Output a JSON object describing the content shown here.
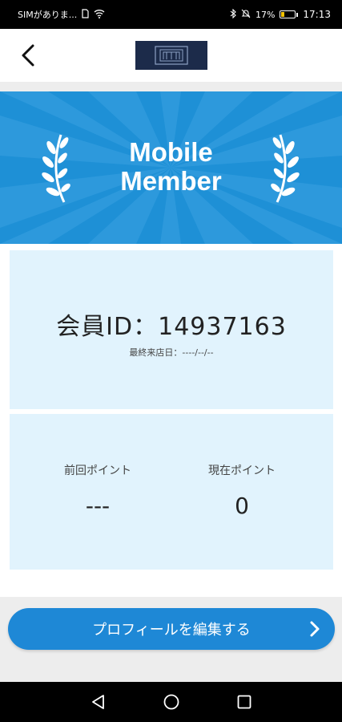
{
  "status_bar": {
    "carrier": "SIMがありま...",
    "battery_percent": "17%",
    "time": "17:13",
    "icons": [
      "sim-card-icon",
      "wifi-icon",
      "bluetooth-icon",
      "mute-icon",
      "battery-icon"
    ]
  },
  "header": {
    "back_icon": "chevron-left-icon",
    "logo_icon": "brand-logo"
  },
  "banner": {
    "title": "Mobile\nMember",
    "color": "#1e90d6"
  },
  "member": {
    "id_text": "会員ID：14937163",
    "last_visit": "最終来店日：----/--/--"
  },
  "points": {
    "previous_label": "前回ポイント",
    "previous_value": "---",
    "current_label": "現在ポイント",
    "current_value": "0"
  },
  "profile_button": {
    "label": "プロフィールを編集する",
    "color": "#1e88d6"
  },
  "nav": {
    "icons": [
      "back-triangle-icon",
      "home-circle-icon",
      "recents-square-icon"
    ]
  }
}
